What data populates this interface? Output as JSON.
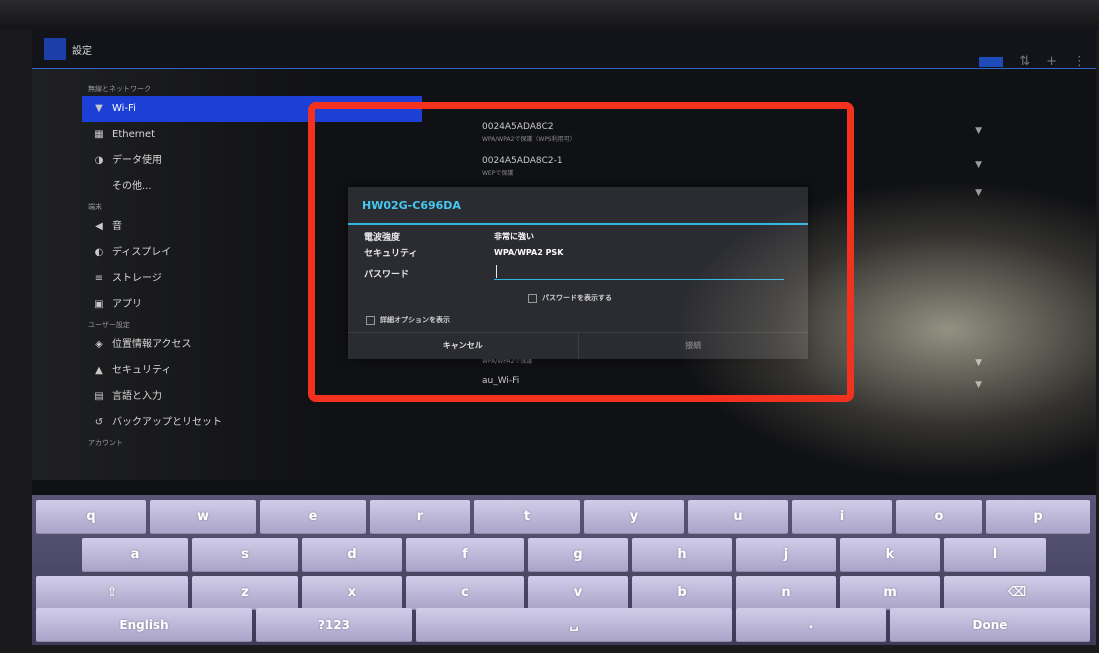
{
  "header": {
    "title": "設定"
  },
  "sidebar": {
    "sections": [
      {
        "title": "無線とネットワーク"
      },
      {
        "title": "端末"
      },
      {
        "title": "ユーザー設定"
      },
      {
        "title": "アカウント"
      }
    ],
    "items": [
      {
        "label": "Wi-Fi",
        "icon": "wifi-icon",
        "glyph": "▼"
      },
      {
        "label": "Ethernet",
        "icon": "ethernet-icon",
        "glyph": "▦"
      },
      {
        "label": "データ使用",
        "icon": "data-usage-icon",
        "glyph": "◑"
      },
      {
        "label": "その他...",
        "icon": "",
        "glyph": ""
      },
      {
        "label": "音",
        "icon": "sound-icon",
        "glyph": "◀"
      },
      {
        "label": "ディスプレイ",
        "icon": "display-icon",
        "glyph": "◐"
      },
      {
        "label": "ストレージ",
        "icon": "storage-icon",
        "glyph": "≡"
      },
      {
        "label": "アプリ",
        "icon": "apps-icon",
        "glyph": "▣"
      },
      {
        "label": "位置情報アクセス",
        "icon": "location-icon",
        "glyph": "◈"
      },
      {
        "label": "セキュリティ",
        "icon": "lock-icon",
        "glyph": "▲"
      },
      {
        "label": "言語と入力",
        "icon": "language-icon",
        "glyph": "▤"
      },
      {
        "label": "バックアップとリセット",
        "icon": "backup-icon",
        "glyph": "↺"
      }
    ]
  },
  "networks": [
    {
      "name": "0024A5ADA8C2",
      "sub": "WPA/WPA2で保護（WPS利用可）"
    },
    {
      "name": "0024A5ADA8C2-1",
      "sub": "WEPで保護"
    },
    {
      "name": "",
      "sub": "WPA/WPA2で保護"
    },
    {
      "name": "au_Wi-Fi",
      "sub": ""
    }
  ],
  "dialog": {
    "title": "HW02G-C696DA",
    "signal_label": "電波強度",
    "signal_value": "非常に強い",
    "security_label": "セキュリティ",
    "security_value": "WPA/WPA2 PSK",
    "password_label": "パスワード",
    "password_value": "",
    "show_password_label": "パスワードを表示する",
    "advanced_label": "詳細オプションを表示",
    "cancel_label": "キャンセル",
    "connect_label": "接続"
  },
  "keyboard": {
    "row1": [
      "q",
      "w",
      "e",
      "r",
      "t",
      "y",
      "u",
      "i",
      "o",
      "p"
    ],
    "row2": [
      "a",
      "s",
      "d",
      "f",
      "g",
      "h",
      "j",
      "k",
      "l"
    ],
    "row3": [
      "z",
      "x",
      "c",
      "v",
      "b",
      "n",
      "m"
    ],
    "shift": "⇧",
    "delete": "⌫",
    "lang": "English",
    "symbols": "?123",
    "space": "␣",
    "period": ".",
    "done": "Done"
  },
  "colors": {
    "accent": "#31b6e7",
    "selection": "#1c3fd6",
    "highlight_box": "#f2311f"
  }
}
